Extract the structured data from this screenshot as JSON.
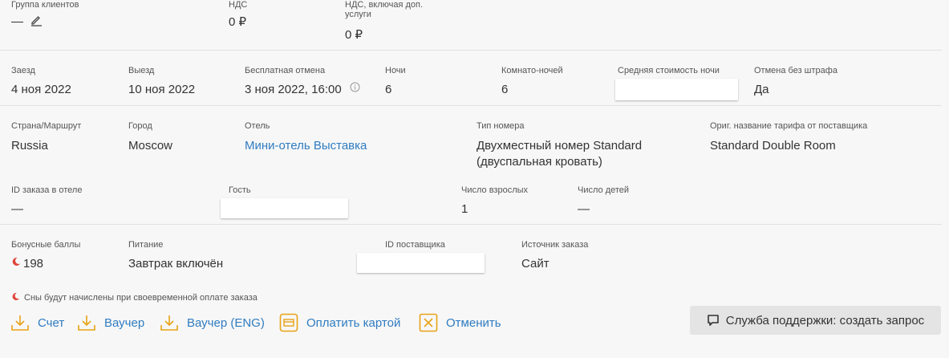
{
  "top": {
    "client_group_label": "Группа клиентов",
    "client_group_value": "—",
    "vat_label": "НДС",
    "vat_value": "0 ₽",
    "vat_extra_label_1": "НДС, включая доп.",
    "vat_extra_label_2": "услуги",
    "vat_extra_value": "0 ₽"
  },
  "stay": {
    "checkin_label": "Заезд",
    "checkin_value": "4 ноя 2022",
    "checkout_label": "Выезд",
    "checkout_value": "10 ноя 2022",
    "free_cancel_label": "Бесплатная отмена",
    "free_cancel_value": "3 ноя 2022, 16:00",
    "nights_label": "Ночи",
    "nights_value": "6",
    "room_nights_label": "Комнато-ночей",
    "room_nights_value": "6",
    "avg_price_label": "Средняя стоимость ночи",
    "no_penalty_label": "Отмена без штрафа",
    "no_penalty_value": "Да"
  },
  "hotel": {
    "country_label": "Страна/Маршрут",
    "country_value": "Russia",
    "city_label": "Город",
    "city_value": "Moscow",
    "hotel_label": "Отель",
    "hotel_value": "Мини-отель Выставка",
    "room_type_label": "Тип номера",
    "room_type_line1": "Двухместный номер Standard",
    "room_type_line2": "(двуспальная кровать)",
    "orig_rate_label": "Ориг. название тарифа от поставщика",
    "orig_rate_value": "Standard Double Room",
    "hotel_order_id_label": "ID заказа в отеле",
    "hotel_order_id_value": "—",
    "guest_label": "Гость",
    "adults_label": "Число взрослых",
    "adults_value": "1",
    "children_label": "Число детей",
    "children_value": "—"
  },
  "extra": {
    "bonus_label": "Бонусные баллы",
    "bonus_value": "198",
    "meal_label": "Питание",
    "meal_value": "Завтрак включён",
    "supplier_id_label": "ID поставщика",
    "source_label": "Источник заказа",
    "source_value": "Сайт",
    "bonus_note": "Сны будут начислены при своевременной оплате заказа"
  },
  "actions": {
    "invoice": "Счет",
    "voucher": "Ваучер",
    "voucher_eng": "Ваучер (ENG)",
    "pay_card": "Оплатить картой",
    "cancel": "Отменить",
    "support": "Служба поддержки: создать запрос"
  },
  "colors": {
    "link": "#2f7cc1",
    "action_icon": "#e8a317",
    "bonus_icon": "#e0463c"
  },
  "icons": {
    "edit": "pencil-icon",
    "download": "download-icon",
    "card": "card-icon",
    "cancel": "cancel-box-icon",
    "support": "chat-bubble-icon",
    "info": "info-icon",
    "bonus": "moon-icon"
  }
}
